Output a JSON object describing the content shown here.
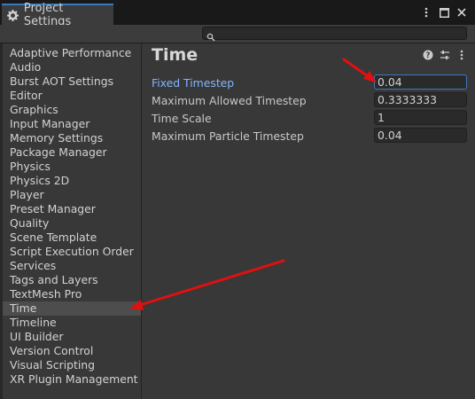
{
  "window": {
    "tab_title": "Project Settings"
  },
  "sidebar": {
    "items": [
      {
        "label": "Adaptive Performance"
      },
      {
        "label": "Audio"
      },
      {
        "label": "Burst AOT Settings"
      },
      {
        "label": "Editor"
      },
      {
        "label": "Graphics"
      },
      {
        "label": "Input Manager"
      },
      {
        "label": "Memory Settings"
      },
      {
        "label": "Package Manager"
      },
      {
        "label": "Physics"
      },
      {
        "label": "Physics 2D"
      },
      {
        "label": "Player"
      },
      {
        "label": "Preset Manager"
      },
      {
        "label": "Quality"
      },
      {
        "label": "Scene Template"
      },
      {
        "label": "Script Execution Order"
      },
      {
        "label": "Services"
      },
      {
        "label": "Tags and Layers"
      },
      {
        "label": "TextMesh Pro"
      },
      {
        "label": "Time"
      },
      {
        "label": "Timeline"
      },
      {
        "label": "UI Builder"
      },
      {
        "label": "Version Control"
      },
      {
        "label": "Visual Scripting"
      },
      {
        "label": "XR Plugin Management"
      }
    ],
    "selected": "Time"
  },
  "main": {
    "title": "Time",
    "fields": [
      {
        "label": "Fixed Timestep",
        "value": "0.04"
      },
      {
        "label": "Maximum Allowed Timestep",
        "value": "0.3333333"
      },
      {
        "label": "Time Scale",
        "value": "1"
      },
      {
        "label": "Maximum Particle Timestep",
        "value": "0.04"
      }
    ]
  },
  "colors": {
    "accent": "#3a79bb",
    "annotation_arrow": "#e01010",
    "active_label": "#82b4ff"
  }
}
